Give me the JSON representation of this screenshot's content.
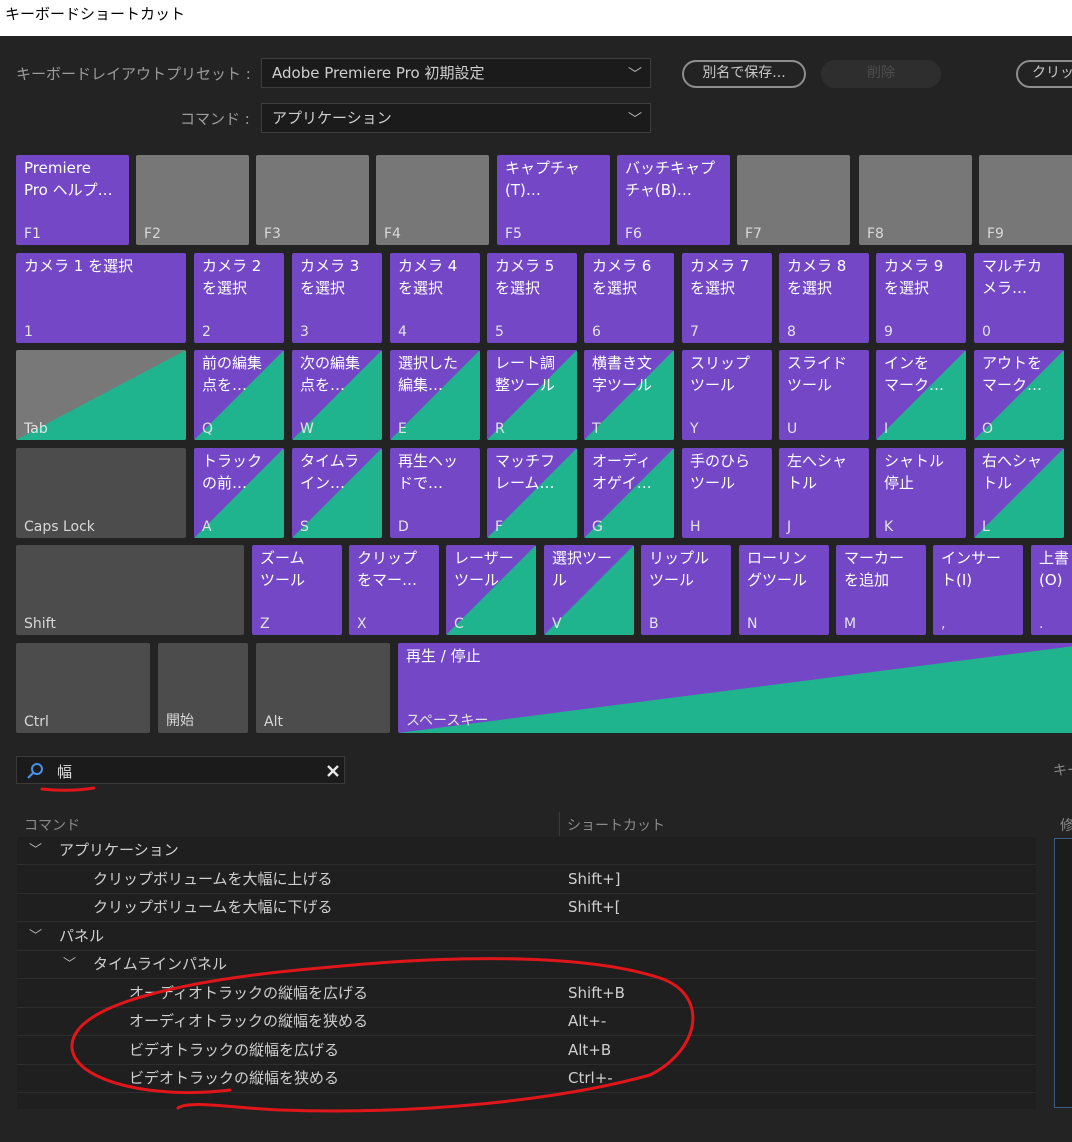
{
  "window": {
    "title": "キーボードショートカット"
  },
  "toolbar": {
    "preset_label": "キーボードレイアウトプリセット :",
    "preset_value": "Adobe Premiere Pro 初期設定",
    "command_label": "コマンド :",
    "command_value": "アプリケーション",
    "save_as": "別名で保存...",
    "delete": "削除",
    "clear": "クリッ"
  },
  "keyboard": {
    "function_row": [
      {
        "key": "F1",
        "command": "Premiere\nPro ヘルプ…",
        "state": "purple"
      },
      {
        "key": "F2",
        "command": "",
        "state": "gray"
      },
      {
        "key": "F3",
        "command": "",
        "state": "gray"
      },
      {
        "key": "F4",
        "command": "",
        "state": "gray"
      },
      {
        "key": "F5",
        "command": "キャプチャ\n(T)…",
        "state": "purple"
      },
      {
        "key": "F6",
        "command": "バッチキャプ\nチャ(B)…",
        "state": "purple"
      },
      {
        "key": "F7",
        "command": "",
        "state": "gray"
      },
      {
        "key": "F8",
        "command": "",
        "state": "gray"
      },
      {
        "key": "F9",
        "command": "",
        "state": "gray"
      }
    ],
    "number_row": [
      {
        "key": "1",
        "command": "カメラ 1 を選択",
        "state": "purple"
      },
      {
        "key": "2",
        "command": "カメラ 2\nを選択",
        "state": "purple"
      },
      {
        "key": "3",
        "command": "カメラ 3\nを選択",
        "state": "purple"
      },
      {
        "key": "4",
        "command": "カメラ 4\nを選択",
        "state": "purple"
      },
      {
        "key": "5",
        "command": "カメラ 5\nを選択",
        "state": "purple"
      },
      {
        "key": "6",
        "command": "カメラ 6\nを選択",
        "state": "purple"
      },
      {
        "key": "7",
        "command": "カメラ 7\nを選択",
        "state": "purple"
      },
      {
        "key": "8",
        "command": "カメラ 8\nを選択",
        "state": "purple"
      },
      {
        "key": "9",
        "command": "カメラ 9\nを選択",
        "state": "purple"
      },
      {
        "key": "0",
        "command": "マルチカ\nメラ…",
        "state": "purple"
      }
    ],
    "q_row": [
      {
        "key": "Tab",
        "command": "",
        "state": "graymix"
      },
      {
        "key": "Q",
        "command": "前の編集\n点を…",
        "state": "mixed"
      },
      {
        "key": "W",
        "command": "次の編集\n点を…",
        "state": "mixed"
      },
      {
        "key": "E",
        "command": "選択した\n編集…",
        "state": "mixed"
      },
      {
        "key": "R",
        "command": "レート調\n整ツール",
        "state": "mixed"
      },
      {
        "key": "T",
        "command": "横書き文\n字ツール",
        "state": "mixed"
      },
      {
        "key": "Y",
        "command": "スリップ\nツール",
        "state": "purple"
      },
      {
        "key": "U",
        "command": "スライド\nツール",
        "state": "purple"
      },
      {
        "key": "I",
        "command": "インを\nマーク…",
        "state": "mixed"
      },
      {
        "key": "O",
        "command": "アウトを\nマーク…",
        "state": "mixed"
      }
    ],
    "a_row": [
      {
        "key": "Caps Lock",
        "command": "",
        "state": "darkgray"
      },
      {
        "key": "A",
        "command": "トラック\nの前…",
        "state": "mixed"
      },
      {
        "key": "S",
        "command": "タイムラ\nイン…",
        "state": "mixed"
      },
      {
        "key": "D",
        "command": "再生ヘッ\nドで…",
        "state": "purple"
      },
      {
        "key": "F",
        "command": "マッチフ\nレーム…",
        "state": "mixed"
      },
      {
        "key": "G",
        "command": "オーディ\nオゲイ…",
        "state": "mixed"
      },
      {
        "key": "H",
        "command": "手のひら\nツール",
        "state": "purple"
      },
      {
        "key": "J",
        "command": "左へシャ\nトル",
        "state": "purple"
      },
      {
        "key": "K",
        "command": "シャトル\n停止",
        "state": "purple"
      },
      {
        "key": "L",
        "command": "右へシャ\nトル",
        "state": "mixed"
      }
    ],
    "z_row": [
      {
        "key": "Shift",
        "command": "",
        "state": "darkgray"
      },
      {
        "key": "Z",
        "command": "ズーム\nツール",
        "state": "purple"
      },
      {
        "key": "X",
        "command": "クリップ\nをマー…",
        "state": "purple"
      },
      {
        "key": "C",
        "command": "レーザー\nツール",
        "state": "mixed"
      },
      {
        "key": "V",
        "command": "選択ツー\nル",
        "state": "mixed"
      },
      {
        "key": "B",
        "command": "リップル\nツール",
        "state": "purple"
      },
      {
        "key": "N",
        "command": "ローリン\nグツール",
        "state": "purple"
      },
      {
        "key": "M",
        "command": "マーカー\nを追加",
        "state": "purple"
      },
      {
        "key": ",",
        "command": "インサー\nト(I)",
        "state": "purple"
      },
      {
        "key": ".",
        "command": "上書\n(O)",
        "state": "purple"
      }
    ],
    "bottom_row": [
      {
        "key": "Ctrl",
        "command": "",
        "state": "darkgray"
      },
      {
        "key": "開始",
        "command": "",
        "state": "darkgray"
      },
      {
        "key": "Alt",
        "command": "",
        "state": "darkgray"
      },
      {
        "key": "スペースキー",
        "command": "再生 / 停止",
        "state": "mixed"
      }
    ]
  },
  "search": {
    "value": "幅"
  },
  "right_panel": {
    "key_label": "キー",
    "col_label": "修"
  },
  "table": {
    "col_command": "コマンド",
    "col_shortcut": "ショートカット",
    "rows": [
      {
        "level": 0,
        "expandable": true,
        "text": "アプリケーション",
        "shortcut": ""
      },
      {
        "level": 2,
        "expandable": false,
        "text": "クリップボリュームを大幅に上げる",
        "shortcut": "Shift+]"
      },
      {
        "level": 2,
        "expandable": false,
        "text": "クリップボリュームを大幅に下げる",
        "shortcut": "Shift+["
      },
      {
        "level": 0,
        "expandable": true,
        "text": "パネル",
        "shortcut": ""
      },
      {
        "level": 1,
        "expandable": true,
        "text": "タイムラインパネル",
        "shortcut": ""
      },
      {
        "level": 3,
        "expandable": false,
        "text": "オーディオトラックの縦幅を広げる",
        "shortcut": "Shift+B"
      },
      {
        "level": 3,
        "expandable": false,
        "text": "オーディオトラックの縦幅を狭める",
        "shortcut": "Alt+-"
      },
      {
        "level": 3,
        "expandable": false,
        "text": "ビデオトラックの縦幅を広げる",
        "shortcut": "Alt+B"
      },
      {
        "level": 3,
        "expandable": false,
        "text": "ビデオトラックの縦幅を狭める",
        "shortcut": "Ctrl+-"
      }
    ]
  },
  "colors": {
    "assigned": "#7447c6",
    "mixed": "#1fb48e",
    "unassigned": "#777777",
    "annotation": "#e0161a"
  }
}
